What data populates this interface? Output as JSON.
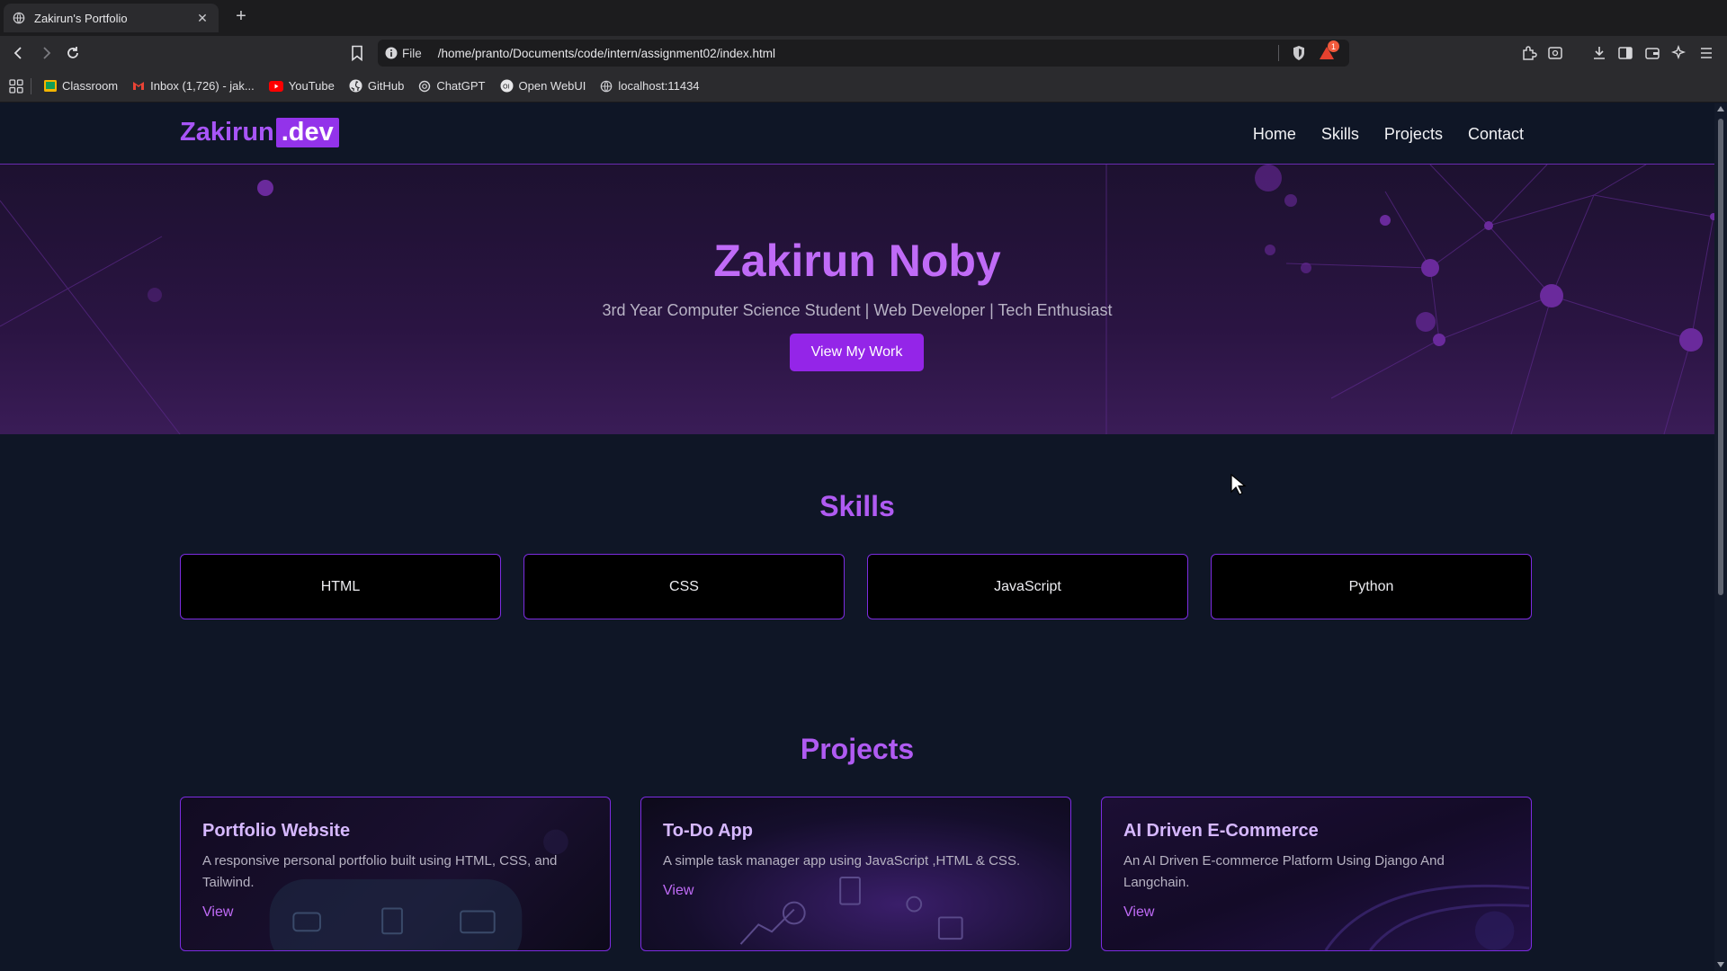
{
  "browser": {
    "tab_title": "Zakirun's Portfolio",
    "url_scheme": "File",
    "url": "/home/pranto/Documents/code/intern/assignment02/index.html",
    "shield_badge": "1",
    "bookmarks": [
      "Classroom",
      "Inbox (1,726) - jak...",
      "YouTube",
      "GitHub",
      "ChatGPT",
      "Open WebUI",
      "localhost:11434"
    ]
  },
  "site": {
    "logo_text": "Zakirun",
    "logo_accent": ".dev",
    "nav": [
      "Home",
      "Skills",
      "Projects",
      "Contact"
    ],
    "hero": {
      "name": "Zakirun Noby",
      "tagline": "3rd Year Computer Science Student | Web Developer | Tech Enthusiast",
      "cta": "View My Work"
    },
    "skills_title": "Skills",
    "skills": [
      "HTML",
      "CSS",
      "JavaScript",
      "Python"
    ],
    "projects_title": "Projects",
    "projects": [
      {
        "title": "Portfolio Website",
        "desc": "A responsive personal portfolio built using HTML, CSS, and Tailwind.",
        "link": "View"
      },
      {
        "title": "To-Do App",
        "desc": "A simple task manager app using JavaScript ,HTML & CSS.",
        "link": "View"
      },
      {
        "title": "AI Driven E-Commerce",
        "desc": "An AI Driven E-commerce Platform Using Django And Langchain.",
        "link": "View"
      }
    ]
  },
  "colors": {
    "accent": "#9333ea",
    "accent_text": "#c06bf7",
    "page_bg": "#0f1626"
  }
}
